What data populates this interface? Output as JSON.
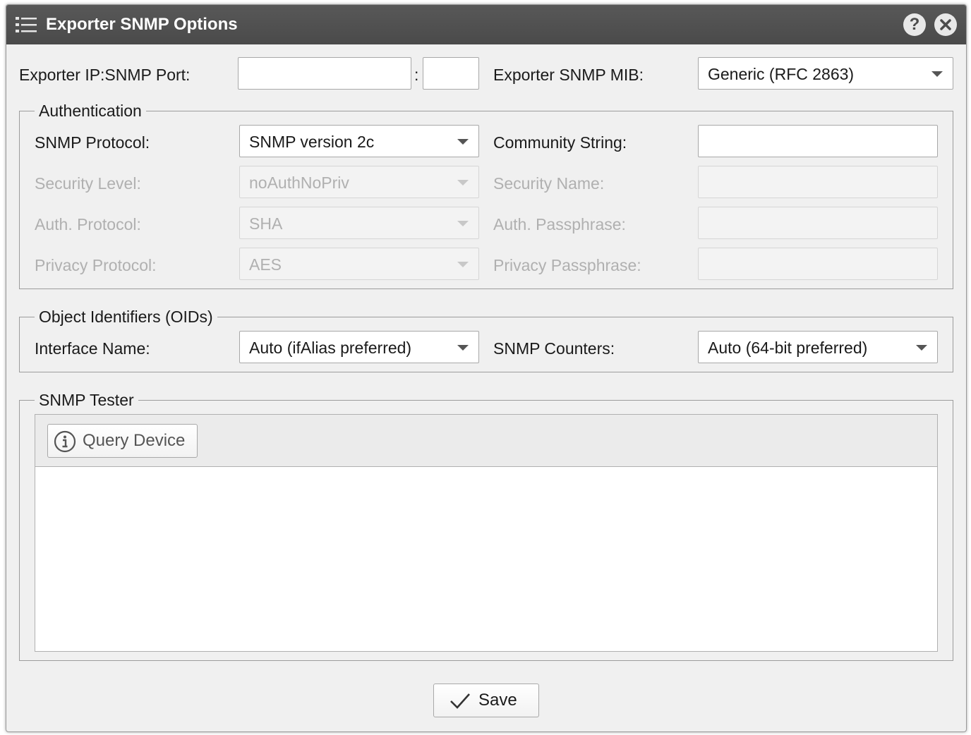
{
  "window": {
    "title": "Exporter SNMP Options",
    "help_glyph": "?",
    "icons": {
      "menu": "list-icon",
      "help": "help-icon",
      "close": "close-icon"
    }
  },
  "exporter": {
    "ip_port_label": "Exporter IP:SNMP Port:",
    "ip_value": "",
    "separator": ":",
    "port_value": "",
    "mib_label": "Exporter SNMP MIB:",
    "mib_value": "Generic (RFC 2863)"
  },
  "authentication": {
    "legend": "Authentication",
    "protocol_label": "SNMP Protocol:",
    "protocol_value": "SNMP version 2c",
    "community_label": "Community String:",
    "community_value": "",
    "security_level_label": "Security Level:",
    "security_level_value": "noAuthNoPriv",
    "security_name_label": "Security Name:",
    "auth_protocol_label": "Auth. Protocol:",
    "auth_protocol_value": "SHA",
    "auth_passphrase_label": "Auth. Passphrase:",
    "privacy_protocol_label": "Privacy Protocol:",
    "privacy_protocol_value": "AES",
    "privacy_passphrase_label": "Privacy Passphrase:"
  },
  "oids": {
    "legend": "Object Identifiers (OIDs)",
    "interface_name_label": "Interface Name:",
    "interface_name_value": "Auto (ifAlias preferred)",
    "counters_label": "SNMP Counters:",
    "counters_value": "Auto (64-bit preferred)"
  },
  "tester": {
    "legend": "SNMP Tester",
    "query_button": "Query Device",
    "query_icon": "info-icon",
    "output": ""
  },
  "footer": {
    "save_button": "Save",
    "save_icon": "checkmark-icon"
  },
  "colors": {
    "titlebar": "#4f4f4f",
    "panel": "#f0f0f0",
    "disabled_text": "#b0b0b0"
  }
}
